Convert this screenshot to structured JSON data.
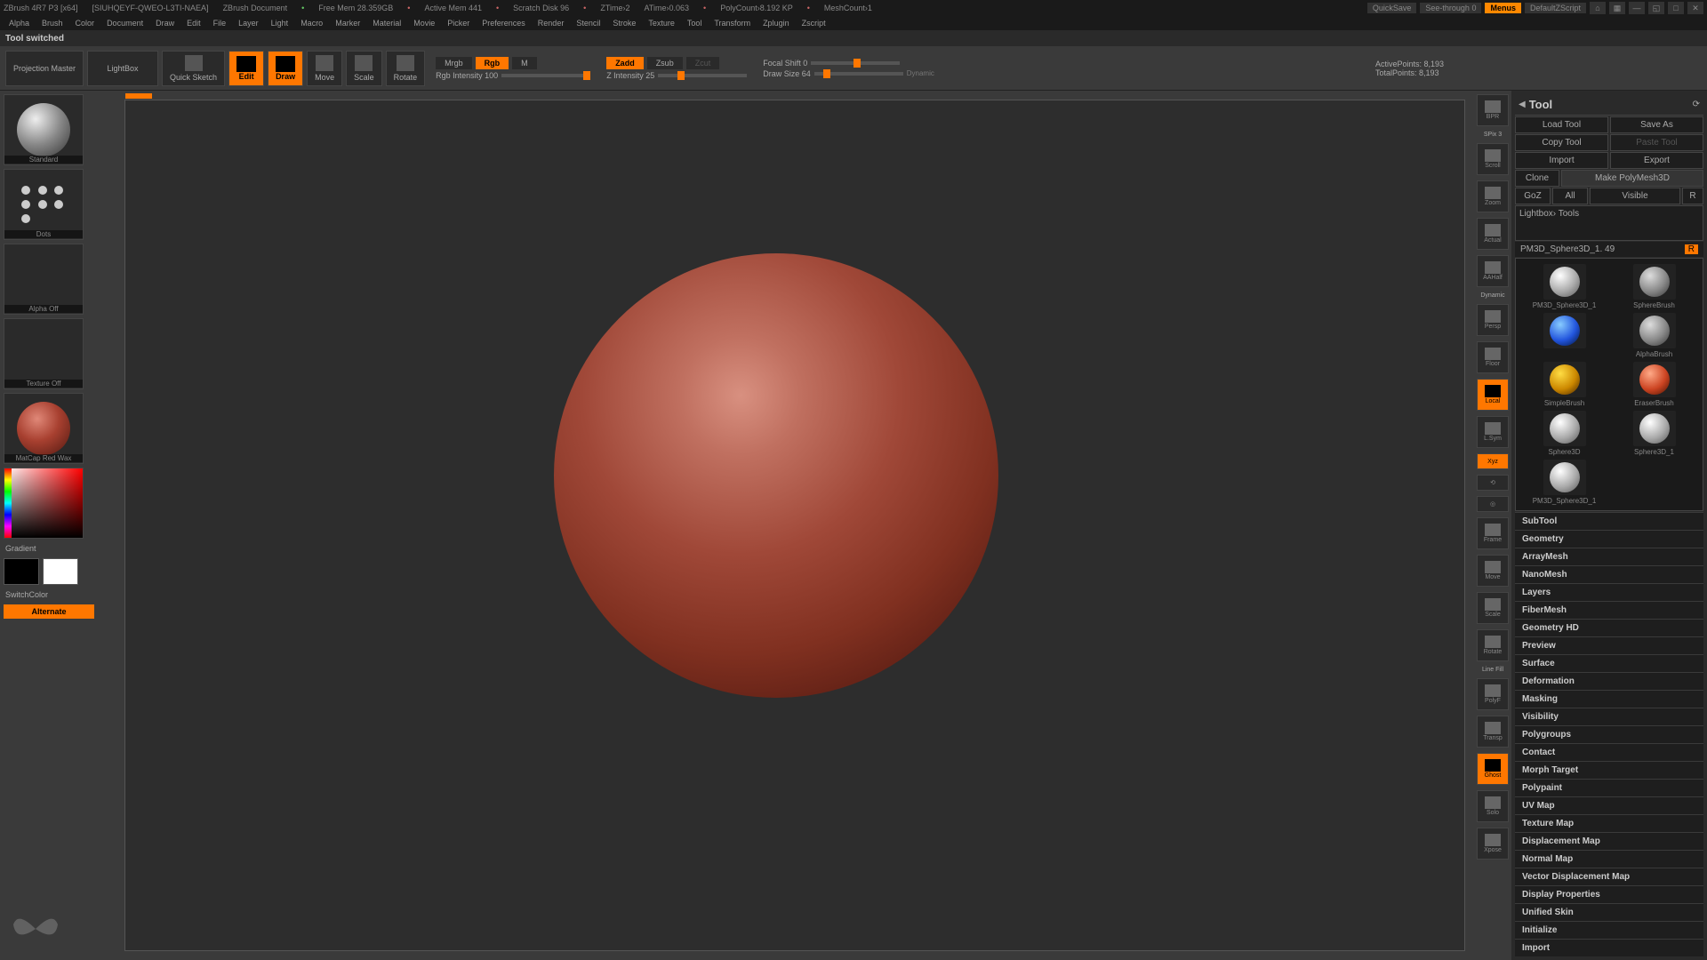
{
  "titlebar": {
    "app": "ZBrush 4R7 P3 [x64]",
    "doc_id": "[SIUHQEYF-QWEO-L3TI-NAEA]",
    "doc_title": "ZBrush Document",
    "free_mem": "Free Mem 28.359GB",
    "active_mem": "Active Mem 441",
    "scratch": "Scratch Disk 96",
    "ztime": "ZTime›2",
    "atime": "ATime›0.063",
    "polycount": "PolyCount›8.192 KP",
    "meshcount": "MeshCount›1",
    "quicksave": "QuickSave",
    "seethrough": "See-through   0",
    "menus": "Menus",
    "script": "DefaultZScript"
  },
  "menubar": [
    "Alpha",
    "Brush",
    "Color",
    "Document",
    "Draw",
    "Edit",
    "File",
    "Layer",
    "Light",
    "Macro",
    "Marker",
    "Material",
    "Movie",
    "Picker",
    "Preferences",
    "Render",
    "Stencil",
    "Stroke",
    "Texture",
    "Tool",
    "Transform",
    "Zplugin",
    "Zscript"
  ],
  "status": "Tool switched",
  "toolbar": {
    "projection": "Projection Master",
    "lightbox": "LightBox",
    "quicksketch": "Quick Sketch",
    "edit": "Edit",
    "draw": "Draw",
    "move": "Move",
    "scale": "Scale",
    "rotate": "Rotate",
    "mrgb": "Mrgb",
    "rgb": "Rgb",
    "m": "M",
    "rgb_int": "Rgb Intensity 100",
    "zadd": "Zadd",
    "zsub": "Zsub",
    "zcut": "Zcut",
    "z_int": "Z Intensity 25",
    "focal": "Focal Shift 0",
    "drawsize": "Draw Size 64",
    "dynamic": "Dynamic",
    "active_pts": "ActivePoints: 8,193",
    "total_pts": "TotalPoints: 8,193"
  },
  "left": {
    "brush_lbl": "Standard",
    "stroke_lbl": "Dots",
    "alpha_lbl": "Alpha Off",
    "texture_lbl": "Texture Off",
    "material_lbl": "MatCap Red Wax",
    "gradient": "Gradient",
    "switchcolor": "SwitchColor",
    "alternate": "Alternate"
  },
  "vstrip": {
    "bpr": "BPR",
    "spix": "SPix 3",
    "scroll": "Scroll",
    "zoom": "Zoom",
    "actual": "Actual",
    "aahalf": "AAHalf",
    "dynamic": "Dynamic",
    "persp": "Persp",
    "floor": "Floor",
    "local": "Local",
    "lsym": "L.Sym",
    "xyz": "Xyz",
    "frame": "Frame",
    "move": "Move",
    "scale": "Scale",
    "rotate": "Rotate",
    "linefill": "Line Fill",
    "polyf": "PolyF",
    "transp": "Transp",
    "ghost": "Ghost",
    "solo": "Solo",
    "xpose": "Xpose"
  },
  "right": {
    "title": "Tool",
    "load": "Load Tool",
    "save": "Save As",
    "copy": "Copy Tool",
    "paste": "Paste Tool",
    "import": "Import",
    "export": "Export",
    "clone": "Clone",
    "makepoly": "Make PolyMesh3D",
    "goz": "GoZ",
    "all": "All",
    "visible": "Visible",
    "r": "R",
    "lightbox_tools": "Lightbox› Tools",
    "toolname": "PM3D_Sphere3D_1. 49",
    "tools": [
      {
        "lbl": "PM3D_Sphere3D_1",
        "cls": "sph-white"
      },
      {
        "lbl": "SphereBrush",
        "cls": "sph-gray"
      },
      {
        "lbl": "",
        "cls": "sph-blue"
      },
      {
        "lbl": "AlphaBrush",
        "cls": "sph-gray"
      },
      {
        "lbl": "SimpleBrush",
        "cls": "sph-gold"
      },
      {
        "lbl": "EraserBrush",
        "cls": "sph-red"
      },
      {
        "lbl": "Sphere3D",
        "cls": "sph-white"
      },
      {
        "lbl": "Sphere3D_1",
        "cls": "sph-white"
      },
      {
        "lbl": "PM3D_Sphere3D_1",
        "cls": "sph-white"
      }
    ],
    "sections": [
      "SubTool",
      "Geometry",
      "ArrayMesh",
      "NanoMesh",
      "Layers",
      "FiberMesh",
      "Geometry HD",
      "Preview",
      "Surface",
      "Deformation",
      "Masking",
      "Visibility",
      "Polygroups",
      "Contact",
      "Morph Target",
      "Polypaint",
      "UV Map",
      "Texture Map",
      "Displacement Map",
      "Normal Map",
      "Vector Displacement Map",
      "Display Properties",
      "Unified Skin",
      "Initialize",
      "Import"
    ]
  }
}
